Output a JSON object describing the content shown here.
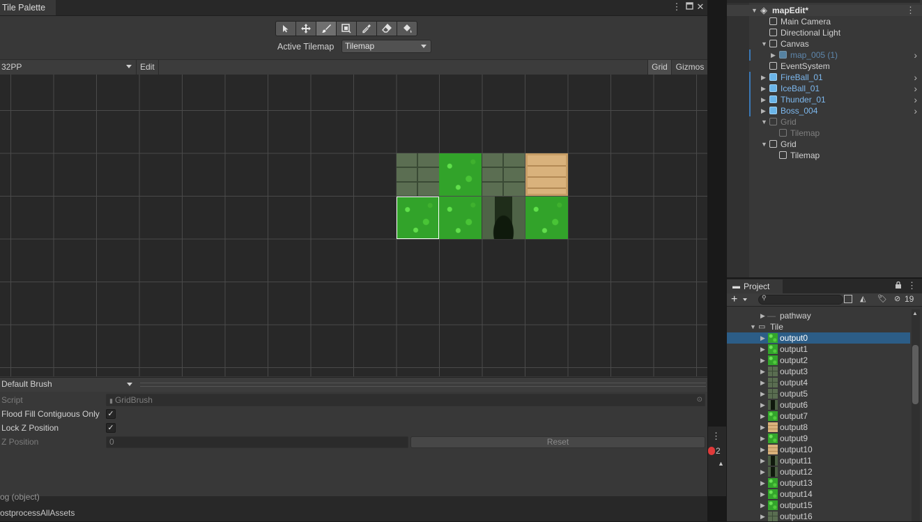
{
  "palette_window": {
    "tab_title": "Tile Palette",
    "active_tilemap_label": "Active Tilemap",
    "active_tilemap_value": "Tilemap",
    "palette_name": "32PP",
    "edit_label": "Edit",
    "grid_label": "Grid",
    "gizmos_label": "Gizmos",
    "tools": [
      "select-tool",
      "move-tool",
      "paint-tool",
      "box-fill-tool",
      "picker-tool",
      "erase-tool",
      "fill-tool"
    ],
    "active_tool": "paint-tool"
  },
  "brush": {
    "name": "Default Brush",
    "script_label": "Script",
    "script_value": "GridBrush",
    "flood_fill_label": "Flood Fill Contiguous Only",
    "flood_fill_checked": true,
    "lock_z_label": "Lock Z Position",
    "lock_z_checked": true,
    "z_position_label": "Z Position",
    "z_position_value": "0",
    "reset_label": "Reset"
  },
  "console": {
    "line1": "og (object)",
    "line2": "ostprocessAllAssets",
    "error_count": "2"
  },
  "hierarchy": {
    "scene_name": "mapEdit*",
    "items": [
      {
        "label": "Main Camera",
        "style": "normal"
      },
      {
        "label": "Directional Light",
        "style": "normal"
      },
      {
        "label": "Canvas",
        "style": "normal"
      },
      {
        "label": "map_005 (1)",
        "style": "prefab-dim"
      },
      {
        "label": "EventSystem",
        "style": "normal"
      },
      {
        "label": "FireBall_01",
        "style": "prefab"
      },
      {
        "label": "IceBall_01",
        "style": "prefab"
      },
      {
        "label": "Thunder_01",
        "style": "prefab"
      },
      {
        "label": "Boss_004",
        "style": "prefab"
      },
      {
        "label": "Grid",
        "style": "disabled"
      },
      {
        "label": "Tilemap",
        "style": "disabled"
      },
      {
        "label": "Grid",
        "style": "normal"
      },
      {
        "label": "Tilemap",
        "style": "normal"
      }
    ]
  },
  "project": {
    "tab_title": "Project",
    "hidden_count": "19",
    "folders": [
      {
        "label": "pathway"
      },
      {
        "label": "Tile"
      }
    ],
    "assets": [
      {
        "label": "output0",
        "kind": "grass",
        "selected": true
      },
      {
        "label": "output1",
        "kind": "grass"
      },
      {
        "label": "output2",
        "kind": "grass"
      },
      {
        "label": "output3",
        "kind": "stone"
      },
      {
        "label": "output4",
        "kind": "stone"
      },
      {
        "label": "output5",
        "kind": "stone"
      },
      {
        "label": "output6",
        "kind": "door"
      },
      {
        "label": "output7",
        "kind": "grass"
      },
      {
        "label": "output8",
        "kind": "crate"
      },
      {
        "label": "output9",
        "kind": "grass"
      },
      {
        "label": "output10",
        "kind": "crate"
      },
      {
        "label": "output11",
        "kind": "door"
      },
      {
        "label": "output12",
        "kind": "door"
      },
      {
        "label": "output13",
        "kind": "grass"
      },
      {
        "label": "output14",
        "kind": "grass"
      },
      {
        "label": "output15",
        "kind": "grass"
      },
      {
        "label": "output16",
        "kind": "stone"
      }
    ]
  },
  "colors": {
    "selection": "#2c5d87",
    "prefab_text": "#7db8ee",
    "error_badge": "#e03a3a"
  }
}
